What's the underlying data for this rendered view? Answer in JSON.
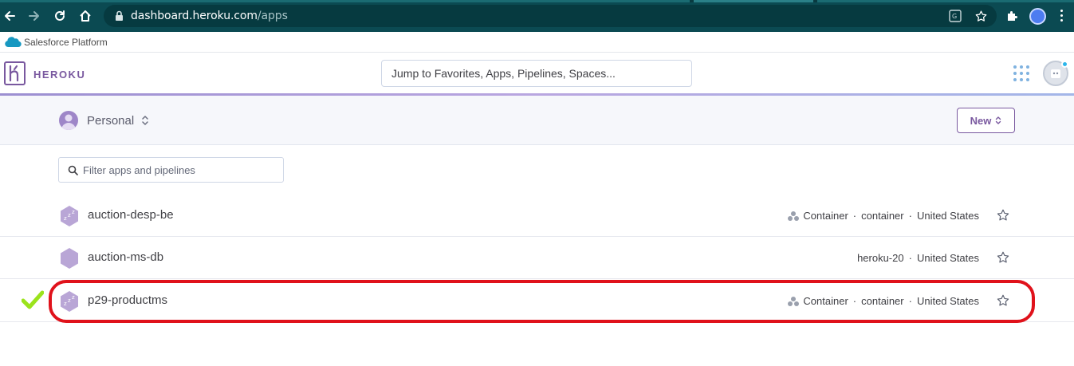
{
  "browser": {
    "url_host": "dashboard.heroku.com",
    "url_path": "/apps"
  },
  "salesforce_bar": {
    "label": "Salesforce Platform"
  },
  "header": {
    "brand": "HEROKU",
    "search_placeholder": "Jump to Favorites, Apps, Pipelines, Spaces..."
  },
  "subheader": {
    "account_label": "Personal",
    "new_button_label": "New"
  },
  "filter": {
    "placeholder": "Filter apps and pipelines"
  },
  "apps": [
    {
      "name": "auction-desp-be",
      "stack": "Container",
      "stack_type": "container",
      "region": "United States",
      "sleeping": true,
      "container_icon": true
    },
    {
      "name": "auction-ms-db",
      "stack": "",
      "stack_type": "heroku-20",
      "region": "United States",
      "sleeping": false,
      "container_icon": false
    },
    {
      "name": "p29-productms",
      "stack": "Container",
      "stack_type": "container",
      "region": "United States",
      "sleeping": true,
      "container_icon": true,
      "highlighted": true
    }
  ],
  "colors": {
    "chrome": "#0b4a52",
    "brand_purple": "#79589f",
    "highlight_red": "#e0121b",
    "check_green": "#9be31c",
    "hex_app": "#b9a6d6"
  },
  "icons": {
    "back": "arrow-left-icon",
    "forward": "arrow-right-icon",
    "reload": "reload-icon",
    "home": "home-icon",
    "lock": "lock-icon",
    "translate": "translate-icon",
    "bookmark": "star-icon",
    "extensions": "puzzle-icon",
    "apps_grid": "grid-icon",
    "search": "search-icon",
    "sleeping": "zzz-icon",
    "container": "container-stack-icon",
    "favorite": "star-outline-icon",
    "check": "checkmark-icon"
  }
}
